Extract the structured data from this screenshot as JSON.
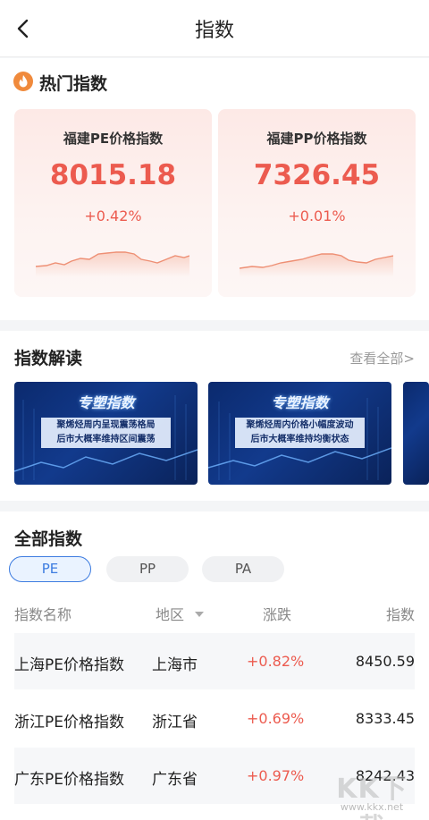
{
  "header": {
    "title": "指数"
  },
  "hot": {
    "title": "热门指数",
    "cards": [
      {
        "name": "福建PE价格指数",
        "value": "8015.18",
        "change": "+0.42%"
      },
      {
        "name": "福建PP价格指数",
        "value": "7326.45",
        "change": "+0.01%"
      }
    ]
  },
  "reading": {
    "title": "指数解读",
    "view_all": "查看全部>",
    "banners": [
      {
        "title": "专塑指数",
        "line1": "聚烯烃周内呈现震荡格局",
        "line2": "后市大概率维持区间震荡"
      },
      {
        "title": "专塑指数",
        "line1": "聚烯烃周内价格小幅度波动",
        "line2": "后市大概率维持均衡状态"
      }
    ]
  },
  "all": {
    "title": "全部指数",
    "tabs": [
      "PE",
      "PP",
      "PA"
    ],
    "selected_tab": "PE",
    "columns": [
      "指数名称",
      "地区",
      "涨跌",
      "指数"
    ],
    "rows": [
      {
        "name": "上海PE价格指数",
        "region": "上海市",
        "change": "+0.82%",
        "value": "8450.59"
      },
      {
        "name": "浙江PE价格指数",
        "region": "浙江省",
        "change": "+0.69%",
        "value": "8333.45"
      },
      {
        "name": "广东PE价格指数",
        "region": "广东省",
        "change": "+0.97%",
        "value": "8242.43"
      }
    ]
  },
  "watermark": {
    "text": "KK下载",
    "url": "www.kkx.net"
  },
  "colors": {
    "up": "#ec5b4f",
    "accent": "#3d7ce0",
    "banner": "#0b2a6e"
  }
}
